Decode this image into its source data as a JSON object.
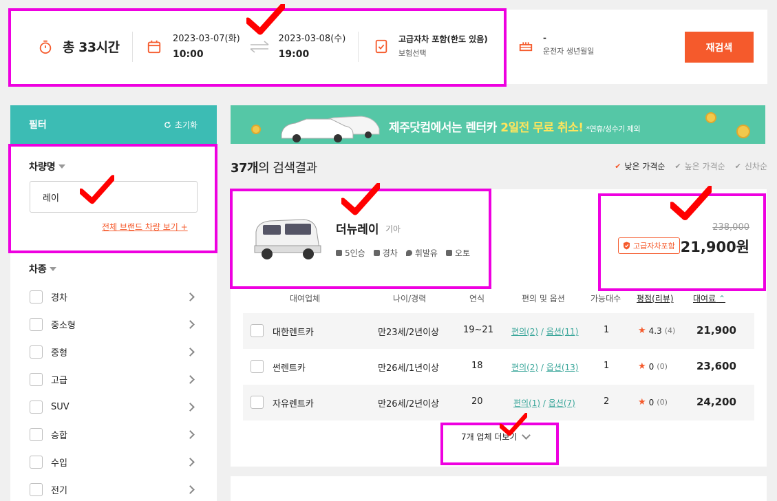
{
  "search": {
    "total_label": "총 33시간",
    "pickup_date": "2023-03-07(화)",
    "pickup_time": "10:00",
    "return_date": "2023-03-08(수)",
    "return_time": "19:00",
    "insurance_title": "고급자차 포함(한도 있음)",
    "insurance_sub": "보험선택",
    "birth_value": "-",
    "birth_label": "운전자 생년월일",
    "research_button": "재검색"
  },
  "sidebar": {
    "filter_title": "필터",
    "reset_label": "초기화",
    "car_name_title": "차량명",
    "car_name_value": "레이",
    "brand_link": "전체 브랜드 차량 보기 +",
    "category_title": "차종",
    "categories": [
      "경차",
      "중소형",
      "중형",
      "고급",
      "SUV",
      "승합",
      "수입",
      "전기"
    ]
  },
  "banner": {
    "text_pre": "제주닷컴에서는 ",
    "text_bold": "렌터카 ",
    "text_highlight": "2일전 무료 취소!",
    "text_small": "*연휴/성수기 제외"
  },
  "results": {
    "count": "37개",
    "count_suffix": "의 검색결과",
    "sort_options": [
      "낮은 가격순",
      "높은 가격순",
      "신차순"
    ]
  },
  "car": {
    "name": "더뉴레이",
    "brand": "기아",
    "specs": [
      "5인승",
      "경차",
      "휘발유",
      "오토"
    ],
    "price_original": "238,000",
    "badge": "고급자차포함",
    "price": "21,900원",
    "columns": [
      "대여업체",
      "나이/경력",
      "연식",
      "편의 및 옵션",
      "가능대수",
      "평점(리뷰)",
      "대여료"
    ],
    "rows": [
      {
        "company": "대한렌트카",
        "age": "만23세/2년이상",
        "year": "19~21",
        "conv": "편의(2)",
        "opt": "옵션(11)",
        "count": "1",
        "rating": "4.3",
        "reviews": "(4)",
        "fee": "21,900"
      },
      {
        "company": "썬렌트카",
        "age": "만26세/1년이상",
        "year": "18",
        "conv": "편의(2)",
        "opt": "옵션(13)",
        "count": "1",
        "rating": "0",
        "reviews": "(0)",
        "fee": "23,600"
      },
      {
        "company": "자유렌트카",
        "age": "만26세/2년이상",
        "year": "20",
        "conv": "편의(1)",
        "opt": "옵션(7)",
        "count": "2",
        "rating": "0",
        "reviews": "(0)",
        "fee": "24,200"
      }
    ],
    "more_label": "7개 업체 더보기"
  },
  "colors": {
    "accent": "#f55a2c",
    "teal": "#3cbcb4",
    "highlight": "#ee00e0",
    "check": "#ff0000"
  }
}
